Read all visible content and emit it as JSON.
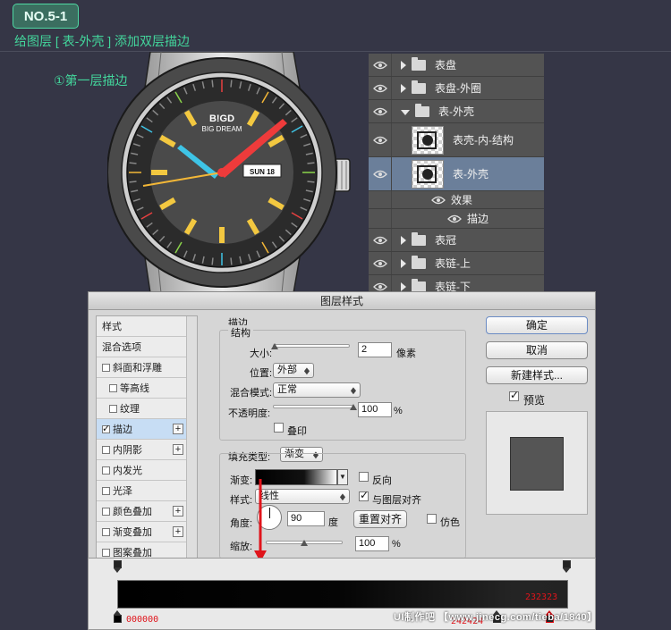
{
  "header": {
    "badge": "NO.5-1",
    "subtitle": "给图层 [ 表-外壳 ] 添加双层描边",
    "step": "①第一层描边"
  },
  "watch": {
    "brand_line1": "B!GD",
    "brand_line2": "BIG DREAM",
    "date": "SUN 18"
  },
  "layers": [
    {
      "label": "表盘",
      "type": "folder",
      "expanded": false
    },
    {
      "label": "表盘-外圈",
      "type": "folder",
      "expanded": false
    },
    {
      "label": "表-外壳",
      "type": "folder",
      "expanded": true
    },
    {
      "label": "表壳-内-结构",
      "type": "layer"
    },
    {
      "label": "表-外壳",
      "type": "layer",
      "selected": true
    },
    {
      "label": "效果",
      "type": "effects"
    },
    {
      "label": "描边",
      "type": "effect"
    },
    {
      "label": "表冠",
      "type": "folder",
      "expanded": false
    },
    {
      "label": "表链-上",
      "type": "folder",
      "expanded": false
    },
    {
      "label": "表链-下",
      "type": "folder",
      "expanded": false
    }
  ],
  "dialog": {
    "title": "图层样式",
    "styles": [
      {
        "label": "样式",
        "checkbox": false,
        "plus": false
      },
      {
        "label": "混合选项",
        "checkbox": false,
        "plus": false
      },
      {
        "label": "斜面和浮雕",
        "checkbox": true,
        "checked": false,
        "plus": false
      },
      {
        "label": "等高线",
        "checkbox": true,
        "checked": false,
        "plus": false,
        "indent": true
      },
      {
        "label": "纹理",
        "checkbox": true,
        "checked": false,
        "plus": false,
        "indent": true
      },
      {
        "label": "描边",
        "checkbox": true,
        "checked": true,
        "plus": true,
        "active": true
      },
      {
        "label": "内阴影",
        "checkbox": true,
        "checked": false,
        "plus": true
      },
      {
        "label": "内发光",
        "checkbox": true,
        "checked": false,
        "plus": false
      },
      {
        "label": "光泽",
        "checkbox": true,
        "checked": false,
        "plus": false
      },
      {
        "label": "颜色叠加",
        "checkbox": true,
        "checked": false,
        "plus": true
      },
      {
        "label": "渐变叠加",
        "checkbox": true,
        "checked": false,
        "plus": true
      },
      {
        "label": "图案叠加",
        "checkbox": true,
        "checked": false,
        "plus": false
      }
    ],
    "stroke": {
      "section": "描边",
      "structure": "结构",
      "size_label": "大小:",
      "size_value": "2",
      "size_unit": "像素",
      "size_level": 0.02,
      "position_label": "位置:",
      "position_value": "外部",
      "blend_label": "混合模式:",
      "blend_value": "正常",
      "opacity_label": "不透明度:",
      "opacity_value": "100",
      "opacity_unit": "%",
      "opacity_level": 1.0,
      "overprint_label": "叠印",
      "fill_type_label": "填充类型:",
      "fill_type_value": "渐变",
      "gradient_label": "渐变:",
      "reverse_label": "反向",
      "style_label": "样式:",
      "style_value": "线性",
      "align_label": "与图层对齐",
      "angle_label": "角度:",
      "angle_value": "90",
      "angle_unit": "度",
      "reset_label": "重置对齐",
      "dither_label": "仿色",
      "scale_label": "缩放:",
      "scale_value": "100",
      "scale_unit": "%",
      "scale_level": 0.5
    },
    "buttons": {
      "ok": "确定",
      "cancel": "取消",
      "new_style": "新建样式...",
      "preview": "预览"
    }
  },
  "gradient_editor": {
    "stop_left_hex": "000000",
    "stop_right_hex": "232323",
    "stop_mid_hex": "242424"
  },
  "watermark": "UI制作吧 【www.jinecg.com/tieba/1840】",
  "colors": {
    "accent_green": "#43d69c",
    "selected_layer": "#6b7f9a",
    "annotation_red": "#e0141b"
  }
}
